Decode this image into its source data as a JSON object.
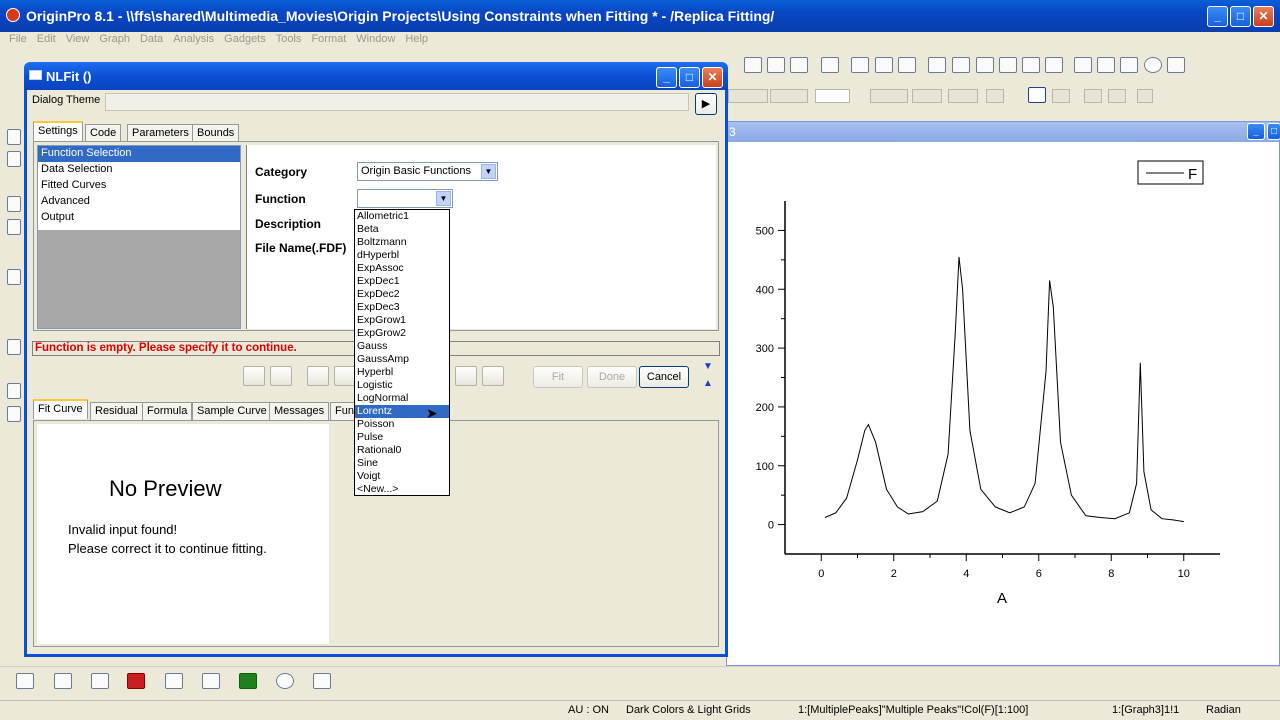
{
  "app": {
    "window_title": "OriginPro 8.1 - \\\\ffs\\shared\\Multimedia_Movies\\Origin Projects\\Using Constraints when Fitting * - /Replica Fitting/",
    "menu": [
      "File",
      "Edit",
      "View",
      "Graph",
      "Data",
      "Analysis",
      "Gadgets",
      "Tools",
      "Format",
      "Window",
      "Help"
    ]
  },
  "dialog": {
    "title": "NLFit ()",
    "theme_label": "Dialog Theme",
    "theme_value": "",
    "top_tabs": [
      "Settings",
      "Code",
      "Parameters",
      "Bounds"
    ],
    "tree_items": [
      "Function Selection",
      "Data Selection",
      "Fitted Curves",
      "Advanced",
      "Output"
    ],
    "fields": {
      "category_label": "Category",
      "category_value": "Origin Basic Functions",
      "function_label": "Function",
      "function_value": "",
      "description_label": "Description",
      "filename_label": "File Name(.FDF)"
    },
    "error_message": "Function is empty. Please specify it to continue.",
    "buttons": {
      "fit": "Fit",
      "done": "Done",
      "cancel": "Cancel"
    },
    "bottom_tabs": [
      "Fit Curve",
      "Residual",
      "Formula",
      "Sample Curve",
      "Messages",
      "Func"
    ],
    "preview": {
      "title": "No Preview",
      "line1": "Invalid input found!",
      "line2": "Please correct it to continue fitting."
    },
    "function_options": [
      "Allometric1",
      "Beta",
      "Boltzmann",
      "dHyperbl",
      "ExpAssoc",
      "ExpDec1",
      "ExpDec2",
      "ExpDec3",
      "ExpGrow1",
      "ExpGrow2",
      "Gauss",
      "GaussAmp",
      "Hyperbl",
      "Logistic",
      "LogNormal",
      "Lorentz",
      "Poisson",
      "Pulse",
      "Rational0",
      "Sine",
      "Voigt",
      "<New...>"
    ],
    "highlighted_option": "Lorentz"
  },
  "graph": {
    "title_fragment": "3",
    "legend_label": "F",
    "xlabel": "A"
  },
  "chart_data": {
    "type": "line",
    "xlabel": "A",
    "ylabel": "",
    "xlim": [
      -1,
      11
    ],
    "ylim": [
      -50,
      550
    ],
    "x_ticks": [
      0,
      2,
      4,
      6,
      8,
      10
    ],
    "y_ticks": [
      0,
      100,
      200,
      300,
      400,
      500
    ],
    "series": [
      {
        "name": "F",
        "x": [
          0.1,
          0.4,
          0.7,
          1.0,
          1.2,
          1.3,
          1.5,
          1.8,
          2.1,
          2.4,
          2.8,
          3.2,
          3.5,
          3.7,
          3.8,
          3.9,
          4.1,
          4.4,
          4.8,
          5.2,
          5.6,
          5.9,
          6.2,
          6.3,
          6.4,
          6.6,
          6.9,
          7.3,
          7.7,
          8.1,
          8.5,
          8.7,
          8.8,
          8.9,
          9.1,
          9.4,
          9.7,
          10.0
        ],
        "y": [
          12,
          20,
          45,
          110,
          160,
          170,
          140,
          60,
          30,
          18,
          22,
          40,
          120,
          330,
          455,
          400,
          160,
          60,
          30,
          20,
          30,
          70,
          260,
          415,
          370,
          140,
          50,
          15,
          12,
          10,
          20,
          70,
          275,
          90,
          25,
          10,
          8,
          5
        ]
      }
    ]
  },
  "status": {
    "au": "AU : ON",
    "theme": "Dark Colors & Light Grids",
    "col": "1:[MultiplePeaks]\"Multiple Peaks\"!Col(F)[1:100]",
    "graph": "1:[Graph3]1!1",
    "angle": "Radian"
  }
}
